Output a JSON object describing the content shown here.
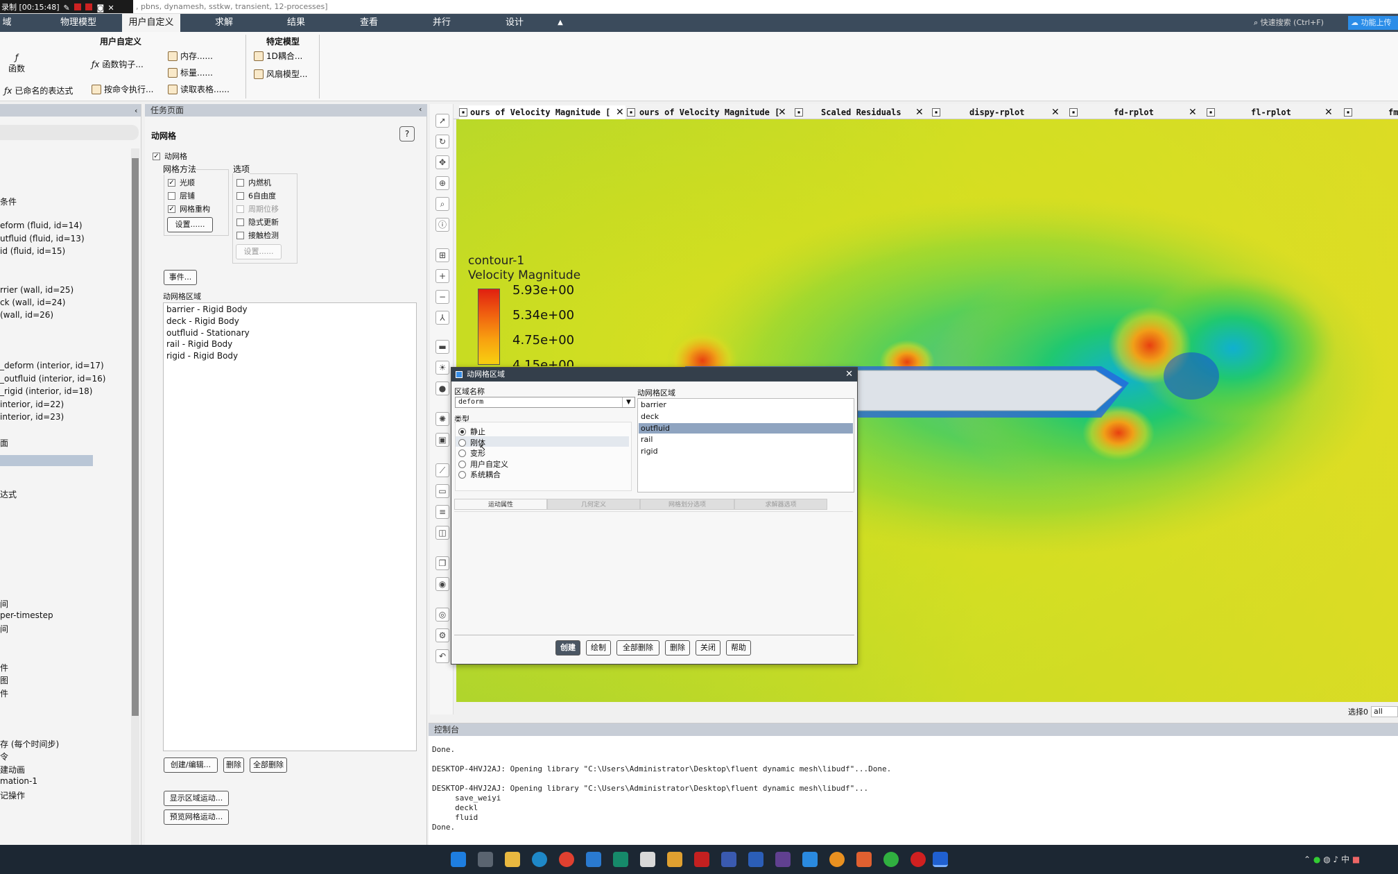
{
  "recorder": {
    "label": "录制 [00:15:48]"
  },
  "window": {
    "title": ", pbns, dynamesh, sstkw, transient, 12-processes]"
  },
  "menu": {
    "items": [
      "域",
      "物理模型",
      "用户自定义",
      "求解",
      "结果",
      "查看",
      "并行",
      "设计"
    ],
    "active_index": 2
  },
  "search": {
    "placeholder": "快速搜索 (Ctrl+F)"
  },
  "cloud_button": {
    "label": "功能上传"
  },
  "ribbon": {
    "group_user": "用户自定义",
    "functions": "函数",
    "function_hooks": "函数钩子...",
    "memory": "内存......",
    "scalars": "标量......",
    "named_expr": "已命名的表达式",
    "execute_cmd": "按命令执行...",
    "read_table": "读取表格......",
    "group_specific": "特定模型",
    "coupling_1d": "1D耦合...",
    "fan_model": "风扇模型..."
  },
  "tree": {
    "items": [
      "条件",
      "eform (fluid, id=14)",
      "utfluid (fluid, id=13)",
      "id (fluid, id=15)",
      "rrier (wall, id=25)",
      "ck (wall, id=24)",
      "(wall, id=26)",
      "_deform (interior, id=17)",
      "_outfluid (interior, id=16)",
      "_rigid (interior, id=18)",
      "interior, id=22)",
      "interior, id=23)",
      "面",
      "达式",
      "间",
      "per-timestep",
      "间",
      "件",
      "图",
      "件",
      "存 (每个时间步)",
      "令",
      "建动画",
      "mation-1",
      "记操作"
    ]
  },
  "task": {
    "header": "任务页面",
    "title": "动网格",
    "dynamic_mesh_label": "动网格",
    "dynamic_mesh_checked": true,
    "mesh_methods_label": "网格方法",
    "options_label": "选项",
    "methods": [
      {
        "label": "光顺",
        "checked": true
      },
      {
        "label": "层铺",
        "checked": false
      },
      {
        "label": "网格重构",
        "checked": true
      }
    ],
    "options": [
      {
        "label": "内燃机",
        "checked": false,
        "disabled": false
      },
      {
        "label": "6自由度",
        "checked": false,
        "disabled": false
      },
      {
        "label": "周期位移",
        "checked": false,
        "disabled": true
      },
      {
        "label": "隐式更新",
        "checked": false,
        "disabled": false
      },
      {
        "label": "接触检测",
        "checked": false,
        "disabled": false
      }
    ],
    "settings_button": "设置......",
    "settings_button_disabled": "设置......",
    "events_button": "事件...",
    "zones_label": "动网格区域",
    "zones": [
      "barrier - Rigid Body",
      "deck - Rigid Body",
      "outfluid - Stationary",
      "rail - Rigid Body",
      "rigid - Rigid Body"
    ],
    "create_edit_button": "创建/编辑...",
    "delete_button": "删除",
    "delete_all_button": "全部删除",
    "show_motion_button": "显示区域运动...",
    "preview_motion_button": "预览网格运动..."
  },
  "tabs": [
    {
      "label": "ours of Velocity Magnitude [",
      "closable": true
    },
    {
      "label": "ours of Velocity Magnitude [",
      "closable": true
    },
    {
      "label": "Scaled Residuals",
      "closable": true
    },
    {
      "label": "dispy-rplot",
      "closable": true
    },
    {
      "label": "fd-rplot",
      "closable": true
    },
    {
      "label": "fl-rplot",
      "closable": true
    },
    {
      "label": "fm",
      "closable": false
    }
  ],
  "graphics": {
    "legend_title": "contour-1",
    "legend_subtitle": "Velocity Magnitude",
    "legend_values": [
      "5.93e+00",
      "5.34e+00",
      "4.75e+00",
      "4.15e+00"
    ],
    "colors": {
      "max": "#e02010",
      "min": "#1030d0",
      "field": "#b8d82a"
    }
  },
  "dialog": {
    "title": "动网格区域",
    "zone_name_label": "区域名称",
    "zone_name_value": "deform",
    "type_label": "类型",
    "types": [
      "静止",
      "刚体",
      "变形",
      "用户自定义",
      "系统耦合"
    ],
    "type_selected": 0,
    "zones_label": "动网格区域",
    "zones": [
      "barrier",
      "deck",
      "outfluid",
      "rail",
      "rigid"
    ],
    "zone_selected": 2,
    "tabs": [
      "运动属性",
      "几何定义",
      "网格划分选项",
      "求解器选项"
    ],
    "active_tab": 0,
    "buttons": {
      "create": "创建",
      "draw": "绘制",
      "delete_all": "全部删除",
      "delete": "删除",
      "close": "关闭",
      "help": "帮助"
    }
  },
  "selection": {
    "label": "选择0",
    "value": "all"
  },
  "console": {
    "header": "控制台",
    "lines": [
      "Done.",
      "",
      "DESKTOP-4HVJ2AJ: Opening library \"C:\\Users\\Administrator\\Desktop\\fluent dynamic mesh\\libudf\"...Done.",
      "",
      "DESKTOP-4HVJ2AJ: Opening library \"C:\\Users\\Administrator\\Desktop\\fluent dynamic mesh\\libudf\"...",
      "     save_weiyi",
      "     deckl",
      "     fluid",
      "Done."
    ]
  },
  "tray": {
    "ime": "中"
  }
}
